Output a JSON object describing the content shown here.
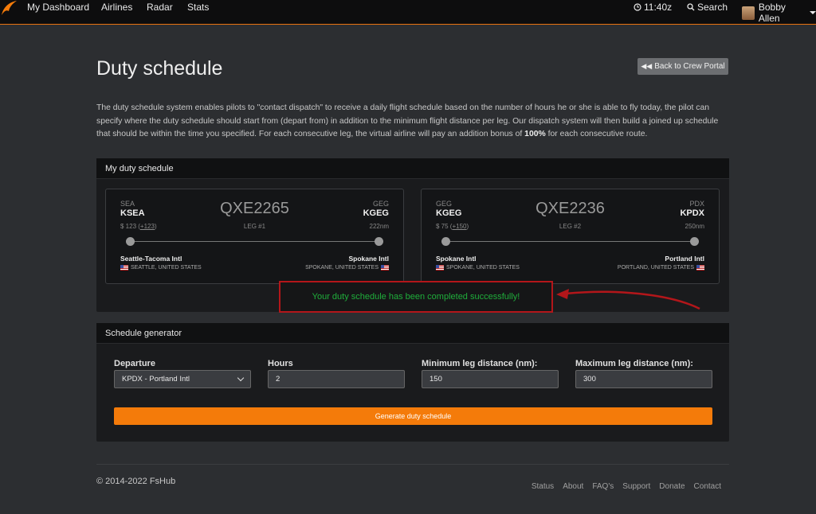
{
  "nav": {
    "items": [
      "My Dashboard",
      "Airlines",
      "Radar",
      "Stats"
    ],
    "time": "11:40z",
    "search": "Search",
    "user": "Bobby Allen"
  },
  "header": {
    "title": "Duty schedule",
    "back": "Back to Crew Portal"
  },
  "intro": {
    "text": "The duty schedule system enables pilots to \"contact dispatch\" to receive a daily flight schedule based on the number of hours he or she is able to fly today, the pilot can specify where the duty schedule should start from (depart from) in addition to the minimum flight distance per leg. Our dispatch system will then build a joined up schedule that should be within the time you specified. For each consecutive leg, the virtual airline will pay an addition bonus of ",
    "bonus": "100%",
    "suffix": " for each consecutive route."
  },
  "schedule": {
    "title": "My duty schedule",
    "legs": [
      {
        "from_iata": "SEA",
        "from_icao": "KSEA",
        "to_iata": "GEG",
        "to_icao": "KGEG",
        "flight": "QXE2265",
        "leg": "LEG #1",
        "pay": "$ 123",
        "bonus": "+123",
        "dist": "222nm",
        "from_name": "Seattle-Tacoma Intl",
        "from_loc": "SEATTLE, UNITED STATES",
        "to_name": "Spokane Intl",
        "to_loc": "SPOKANE, UNITED STATES"
      },
      {
        "from_iata": "GEG",
        "from_icao": "KGEG",
        "to_iata": "PDX",
        "to_icao": "KPDX",
        "flight": "QXE2236",
        "leg": "LEG #2",
        "pay": "$ 75",
        "bonus": "+150",
        "dist": "250nm",
        "from_name": "Spokane Intl",
        "from_loc": "SPOKANE, UNITED STATES",
        "to_name": "Portland Intl",
        "to_loc": "PORTLAND, UNITED STATES"
      }
    ],
    "success": "Your duty schedule has been completed successfully!"
  },
  "generator": {
    "title": "Schedule generator",
    "departure_label": "Departure",
    "departure_value": "KPDX - Portland Intl",
    "hours_label": "Hours",
    "hours_value": "2",
    "min_label": "Minimum leg distance (nm):",
    "min_value": "150",
    "max_label": "Maximum leg distance (nm):",
    "max_value": "300",
    "button": "Generate duty schedule"
  },
  "footer": {
    "copyright": "© 2014-2022 FsHub",
    "links": [
      "Status",
      "About",
      "FAQ's",
      "Support",
      "Donate",
      "Contact"
    ]
  },
  "colors": {
    "accent": "#f47b0a",
    "success_text": "#1fae3b",
    "annotation": "#b3161a"
  }
}
